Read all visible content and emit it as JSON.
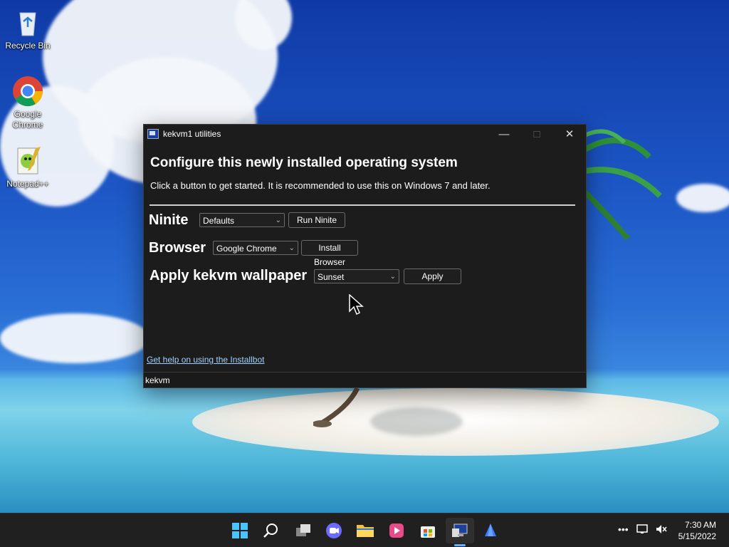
{
  "desktop": {
    "icons": [
      {
        "label": "Recycle Bin",
        "icon": "recycle-bin-icon"
      },
      {
        "label": "Google Chrome",
        "icon": "chrome-icon"
      },
      {
        "label": "Notepad++",
        "icon": "notepadpp-icon"
      }
    ]
  },
  "window": {
    "title": "kekvm1 utilities",
    "heading": "Configure this newly installed operating system",
    "subtitle": "Click a button to get started. It is recommended to use this on Windows 7 and later.",
    "rows": {
      "ninite": {
        "label": "Ninite",
        "select_value": "Defaults",
        "button": "Run Ninite"
      },
      "browser": {
        "label": "Browser",
        "select_value": "Google Chrome",
        "button": "Install Browser"
      },
      "wallpaper": {
        "label": "Apply kekvm wallpaper",
        "select_value": "Sunset",
        "button": "Apply"
      }
    },
    "help_link": "Get help on using the Installbot",
    "status": "kekvm"
  },
  "taskbar": {
    "icons": [
      "start-icon",
      "search-icon",
      "task-view-icon",
      "chat-icon",
      "file-explorer-icon",
      "media-icon",
      "store-icon",
      "utility-app-icon",
      "installbot-icon"
    ],
    "time": "7:30 AM",
    "date": "5/15/2022"
  },
  "colors": {
    "window_bg": "#1c1c1c",
    "link": "#9fd0ff",
    "taskbar_bg": "#202020",
    "accent": "#5fb2ff"
  }
}
